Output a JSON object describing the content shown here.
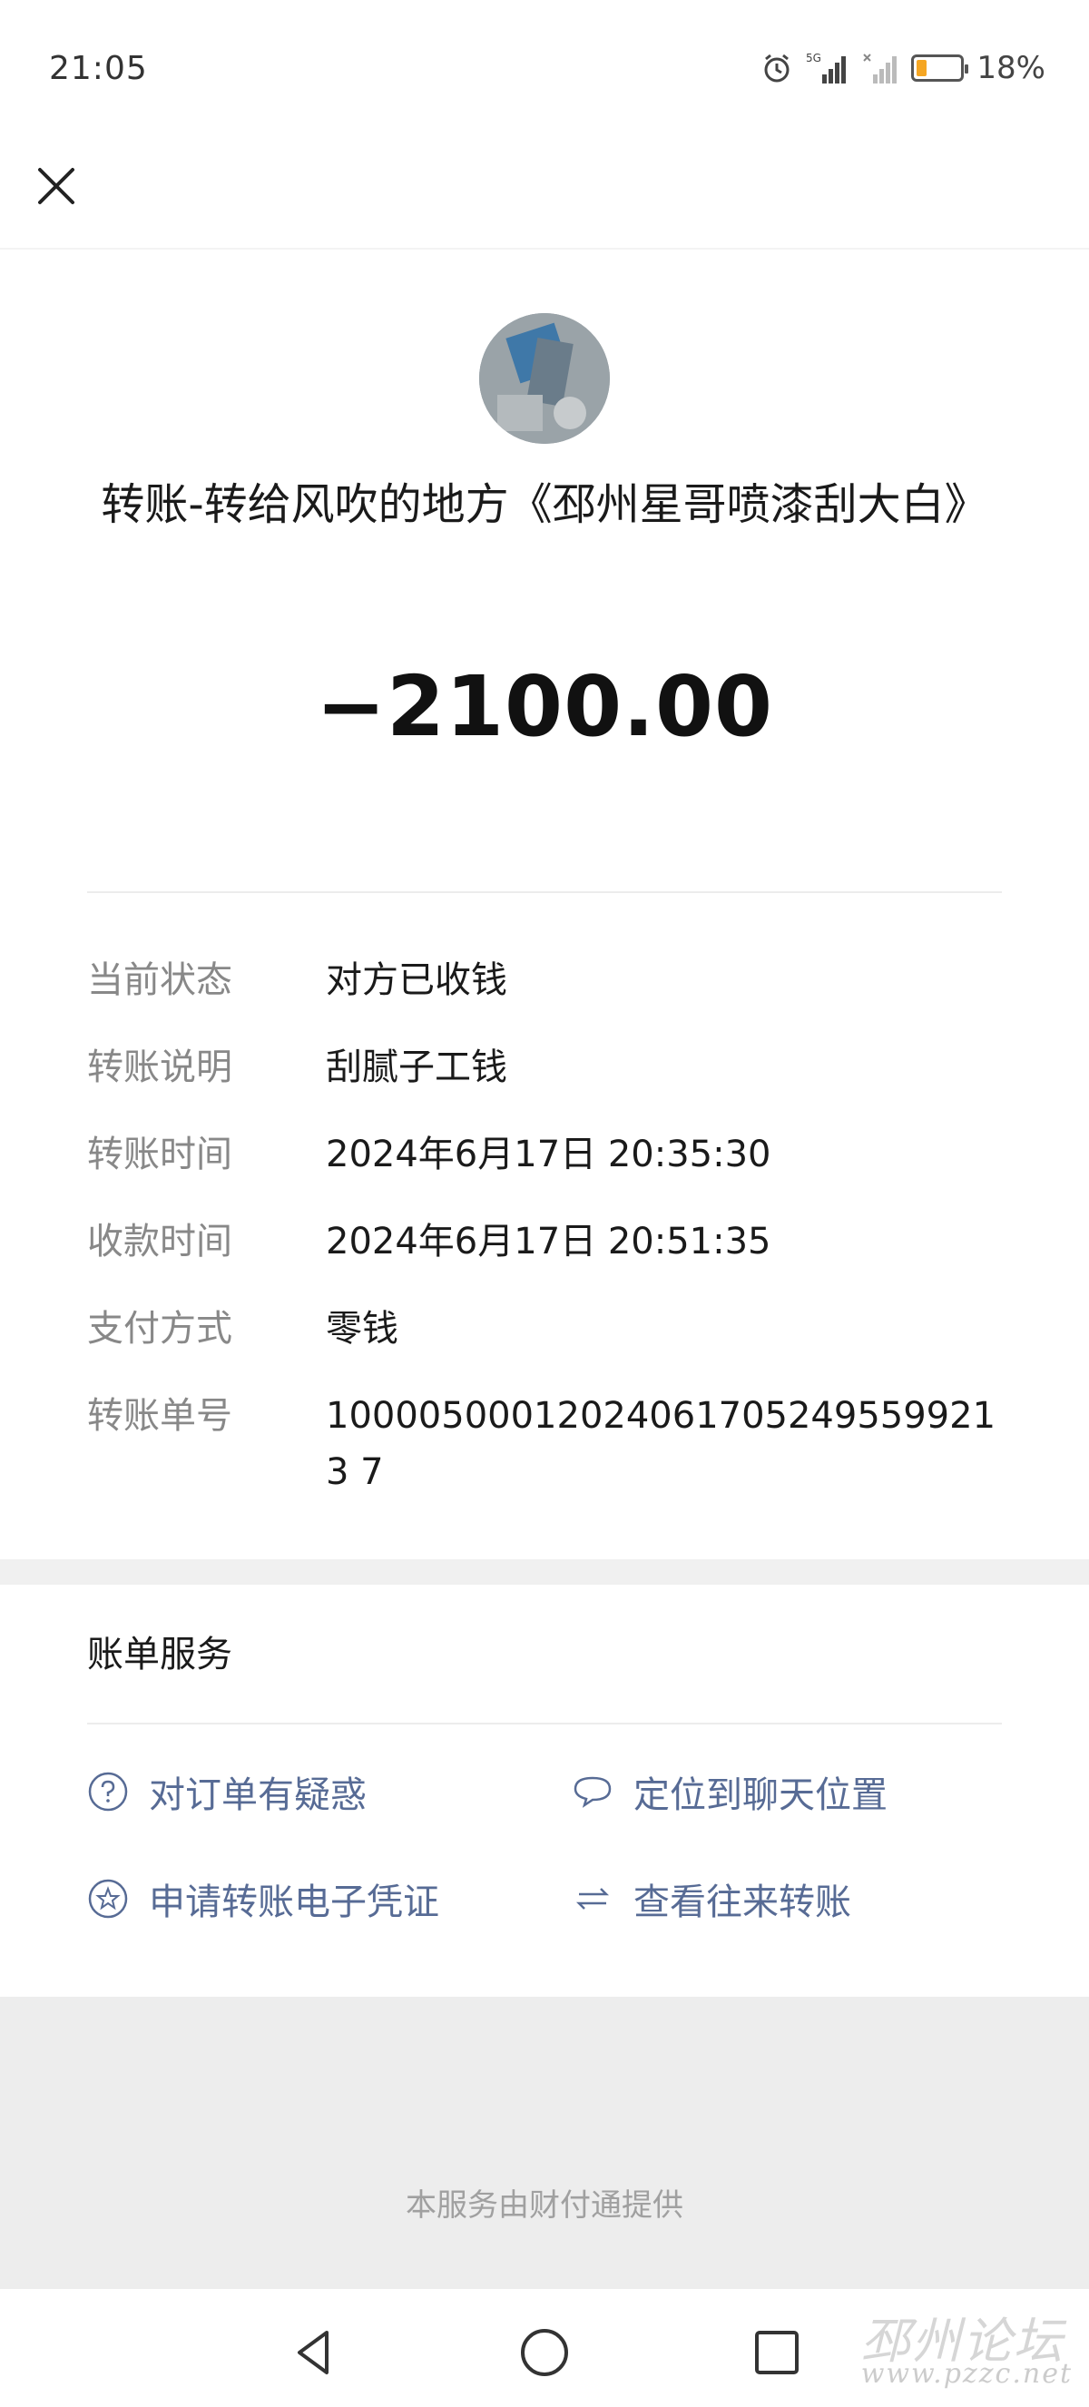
{
  "status_bar": {
    "time": "21:05",
    "battery_percent": "18%",
    "network": "5G",
    "icons": [
      "alarm-icon",
      "signal-5g-icon",
      "signal-empty-icon",
      "battery-icon"
    ]
  },
  "header": {
    "close_icon": "close-icon"
  },
  "transfer": {
    "title": "转账-转给风吹的地方《邳州星哥喷漆刮大白》",
    "amount": "−2100.00"
  },
  "details": [
    {
      "label": "当前状态",
      "value": "对方已收钱"
    },
    {
      "label": "转账说明",
      "value": "刮腻子工钱"
    },
    {
      "label": "转账时间",
      "value": "2024年6月17日 20:35:30"
    },
    {
      "label": "收款时间",
      "value": "2024年6月17日 20:51:35"
    },
    {
      "label": "支付方式",
      "value": "零钱"
    },
    {
      "label": "转账单号",
      "value": "100005000120240617052495599213 7"
    }
  ],
  "bill_services": {
    "title": "账单服务",
    "items": [
      {
        "label": "对订单有疑惑",
        "icon": "question-icon"
      },
      {
        "label": "定位到聊天位置",
        "icon": "chat-bubble-icon"
      },
      {
        "label": "申请转账电子凭证",
        "icon": "star-badge-icon"
      },
      {
        "label": "查看往来转账",
        "icon": "exchange-arrows-icon"
      }
    ]
  },
  "footer": {
    "provider": "本服务由财付通提供"
  },
  "nav": {
    "back_icon": "back-triangle-icon",
    "home_icon": "home-circle-icon",
    "recents_icon": "recents-square-icon"
  },
  "watermark": {
    "main": "邳州论坛",
    "sub": "www.pzzc.net"
  },
  "colors": {
    "link": "#576b95",
    "label_gray": "#888888",
    "band_gray": "#f0f0f0",
    "battery_orange": "#f5a623"
  }
}
